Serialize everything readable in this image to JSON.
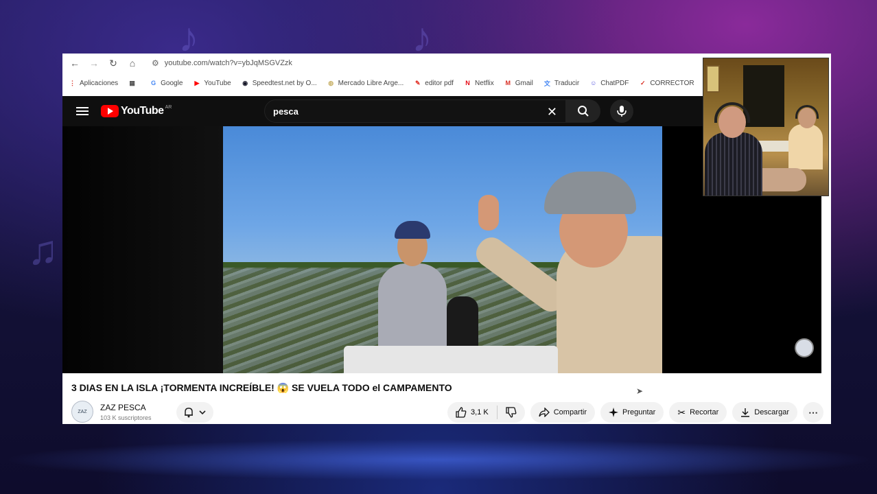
{
  "browser": {
    "url": "youtube.com/watch?v=ybJqMSGVZzk",
    "bookmarks": [
      {
        "label": "Aplicaciones",
        "icon": "apps-grid-icon",
        "color": "#d93025"
      },
      {
        "label": "",
        "icon": "grid-icon",
        "color": "#555555"
      },
      {
        "label": "Google",
        "icon": "google-icon",
        "color": "#4285f4"
      },
      {
        "label": "YouTube",
        "icon": "youtube-icon",
        "color": "#ff0000"
      },
      {
        "label": "Speedtest.net by O...",
        "icon": "speedtest-icon",
        "color": "#141526"
      },
      {
        "label": "Mercado Libre Arge...",
        "icon": "mercadolibre-icon",
        "color": "#c9b26a"
      },
      {
        "label": "editor pdf",
        "icon": "pdf-icon",
        "color": "#e2352b"
      },
      {
        "label": "Netflix",
        "icon": "netflix-icon",
        "color": "#e50914"
      },
      {
        "label": "Gmail",
        "icon": "gmail-icon",
        "color": "#d93025"
      },
      {
        "label": "Traducir",
        "icon": "translate-icon",
        "color": "#4285f4"
      },
      {
        "label": "ChatPDF",
        "icon": "chatpdf-icon",
        "color": "#5a5adf"
      },
      {
        "label": "CORRECTOR",
        "icon": "checkmark-icon",
        "color": "#d93025"
      }
    ]
  },
  "youtube": {
    "logo_text": "YouTube",
    "country_code": "AR",
    "search_value": "pesca",
    "video": {
      "title": "3 DIAS EN LA ISLA ¡TORMENTA INCREÍBLE! 😱 SE VUELA TODO el CAMPAMENTO",
      "channel_name": "ZAZ PESCA",
      "subscribers": "103 K suscriptores",
      "channel_avatar_text": "ZAZ",
      "likes": "3,1 K"
    },
    "actions": {
      "share": "Compartir",
      "ask": "Preguntar",
      "clip": "Recortar",
      "download": "Descargar"
    }
  },
  "colors": {
    "yt_red": "#ff0000",
    "yt_dark": "#0f0f0f",
    "pill_bg": "#f2f2f2"
  }
}
